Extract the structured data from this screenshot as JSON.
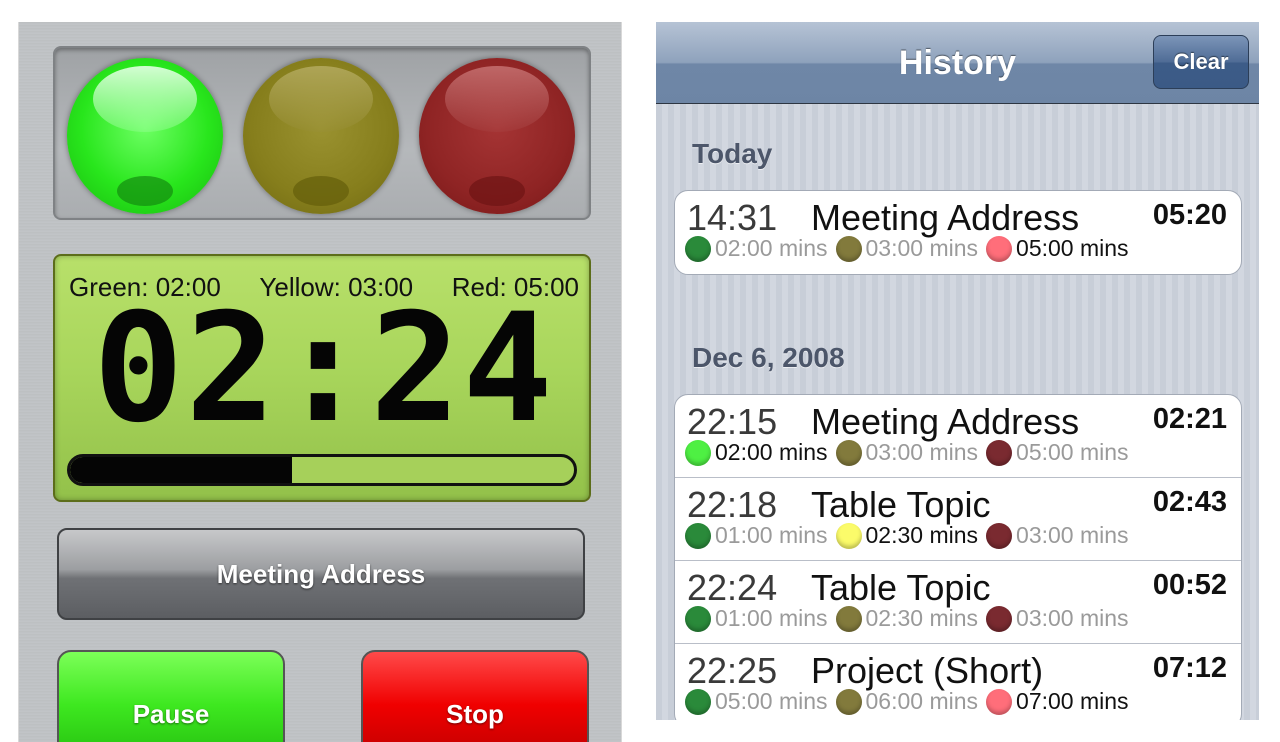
{
  "colors": {
    "green_on": "#4ef043",
    "green_off": "#2a8a3a",
    "yellow_on": "#fbfb6a",
    "yellow_off": "#827a3c",
    "red_on": "#ff6e7a",
    "red_off": "#7a2a30"
  },
  "timer": {
    "thresholds": {
      "green": "Green: 02:00",
      "yellow": "Yellow: 03:00",
      "red": "Red: 05:00"
    },
    "time": "02:24",
    "progress_fraction": 0.44,
    "speech_type_label": "Meeting Address",
    "pause_label": "Pause",
    "stop_label": "Stop"
  },
  "history": {
    "title": "History",
    "clear_label": "Clear",
    "sections": [
      {
        "header": "Today",
        "entries": [
          {
            "time": "14:31",
            "name": "Meeting Address",
            "duration": "05:20",
            "marks": [
              {
                "color": "green",
                "state": "off",
                "text": "02:00 mins"
              },
              {
                "color": "yellow",
                "state": "off",
                "text": "03:00 mins"
              },
              {
                "color": "red",
                "state": "on",
                "text": "05:00 mins"
              }
            ]
          }
        ]
      },
      {
        "header": "Dec 6, 2008",
        "entries": [
          {
            "time": "22:15",
            "name": "Meeting Address",
            "duration": "02:21",
            "marks": [
              {
                "color": "green",
                "state": "on",
                "text": "02:00 mins"
              },
              {
                "color": "yellow",
                "state": "off",
                "text": "03:00 mins"
              },
              {
                "color": "red",
                "state": "off",
                "text": "05:00 mins"
              }
            ]
          },
          {
            "time": "22:18",
            "name": "Table Topic",
            "duration": "02:43",
            "marks": [
              {
                "color": "green",
                "state": "off",
                "text": "01:00 mins"
              },
              {
                "color": "yellow",
                "state": "on",
                "text": "02:30 mins"
              },
              {
                "color": "red",
                "state": "off",
                "text": "03:00 mins"
              }
            ]
          },
          {
            "time": "22:24",
            "name": "Table Topic",
            "duration": "00:52",
            "marks": [
              {
                "color": "green",
                "state": "off",
                "text": "01:00 mins"
              },
              {
                "color": "yellow",
                "state": "off",
                "text": "02:30 mins"
              },
              {
                "color": "red",
                "state": "off",
                "text": "03:00 mins"
              }
            ]
          },
          {
            "time": "22:25",
            "name": "Project (Short)",
            "duration": "07:12",
            "marks": [
              {
                "color": "green",
                "state": "off",
                "text": "05:00 mins"
              },
              {
                "color": "yellow",
                "state": "off",
                "text": "06:00 mins"
              },
              {
                "color": "red",
                "state": "on",
                "text": "07:00 mins"
              }
            ]
          }
        ]
      }
    ]
  }
}
